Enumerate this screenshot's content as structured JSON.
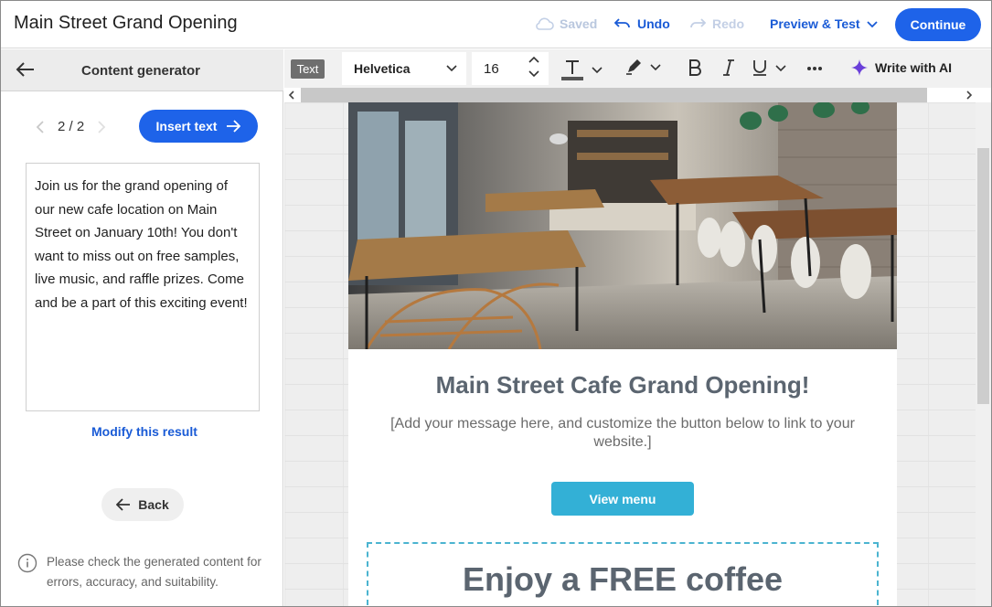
{
  "header": {
    "title": "Main Street Grand Opening",
    "saved_label": "Saved",
    "undo_label": "Undo",
    "redo_label": "Redo",
    "preview_label": "Preview & Test",
    "continue_label": "Continue"
  },
  "sidebar": {
    "title": "Content generator",
    "pager": "2 / 2",
    "insert_label": "Insert text",
    "generated_text": "Join us for the grand opening of our new cafe location on Main Street on January 10th! You don't want to miss out on free samples, live music, and raffle prizes. Come and be a part of this exciting event!",
    "modify_label": "Modify this result",
    "back_label": "Back",
    "disclaimer": "Please check the generated content for errors, accuracy, and suitability."
  },
  "toolbar": {
    "block_type": "Text",
    "font": "Helvetica",
    "font_size": "16",
    "ai_label": "Write with AI"
  },
  "email": {
    "title": "Main Street Cafe Grand Opening!",
    "message": "[Add your message here, and customize the button below to link to your website.]",
    "button_label": "View menu",
    "promo_title": "Enjoy a FREE coffee"
  },
  "colors": {
    "primary": "#1e63e9",
    "link": "#1a5bd6",
    "email_button": "#33b0d6",
    "email_heading": "#5b6570",
    "ai_sparkle": "#6a3fd9"
  }
}
